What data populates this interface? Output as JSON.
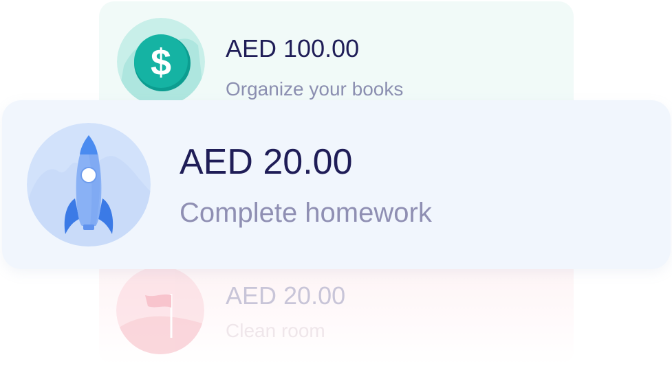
{
  "items": [
    {
      "amount": "AED 100.00",
      "task": "Organize your books",
      "icon": "dollar-coin-icon",
      "accent": "#15b3a3"
    },
    {
      "amount": "AED 20.00",
      "task": "Complete homework",
      "icon": "rocket-icon",
      "accent": "#4a8bf0"
    },
    {
      "amount": "AED 20.00",
      "task": "Clean room",
      "icon": "flag-icon",
      "accent": "#f4a9b4"
    }
  ]
}
